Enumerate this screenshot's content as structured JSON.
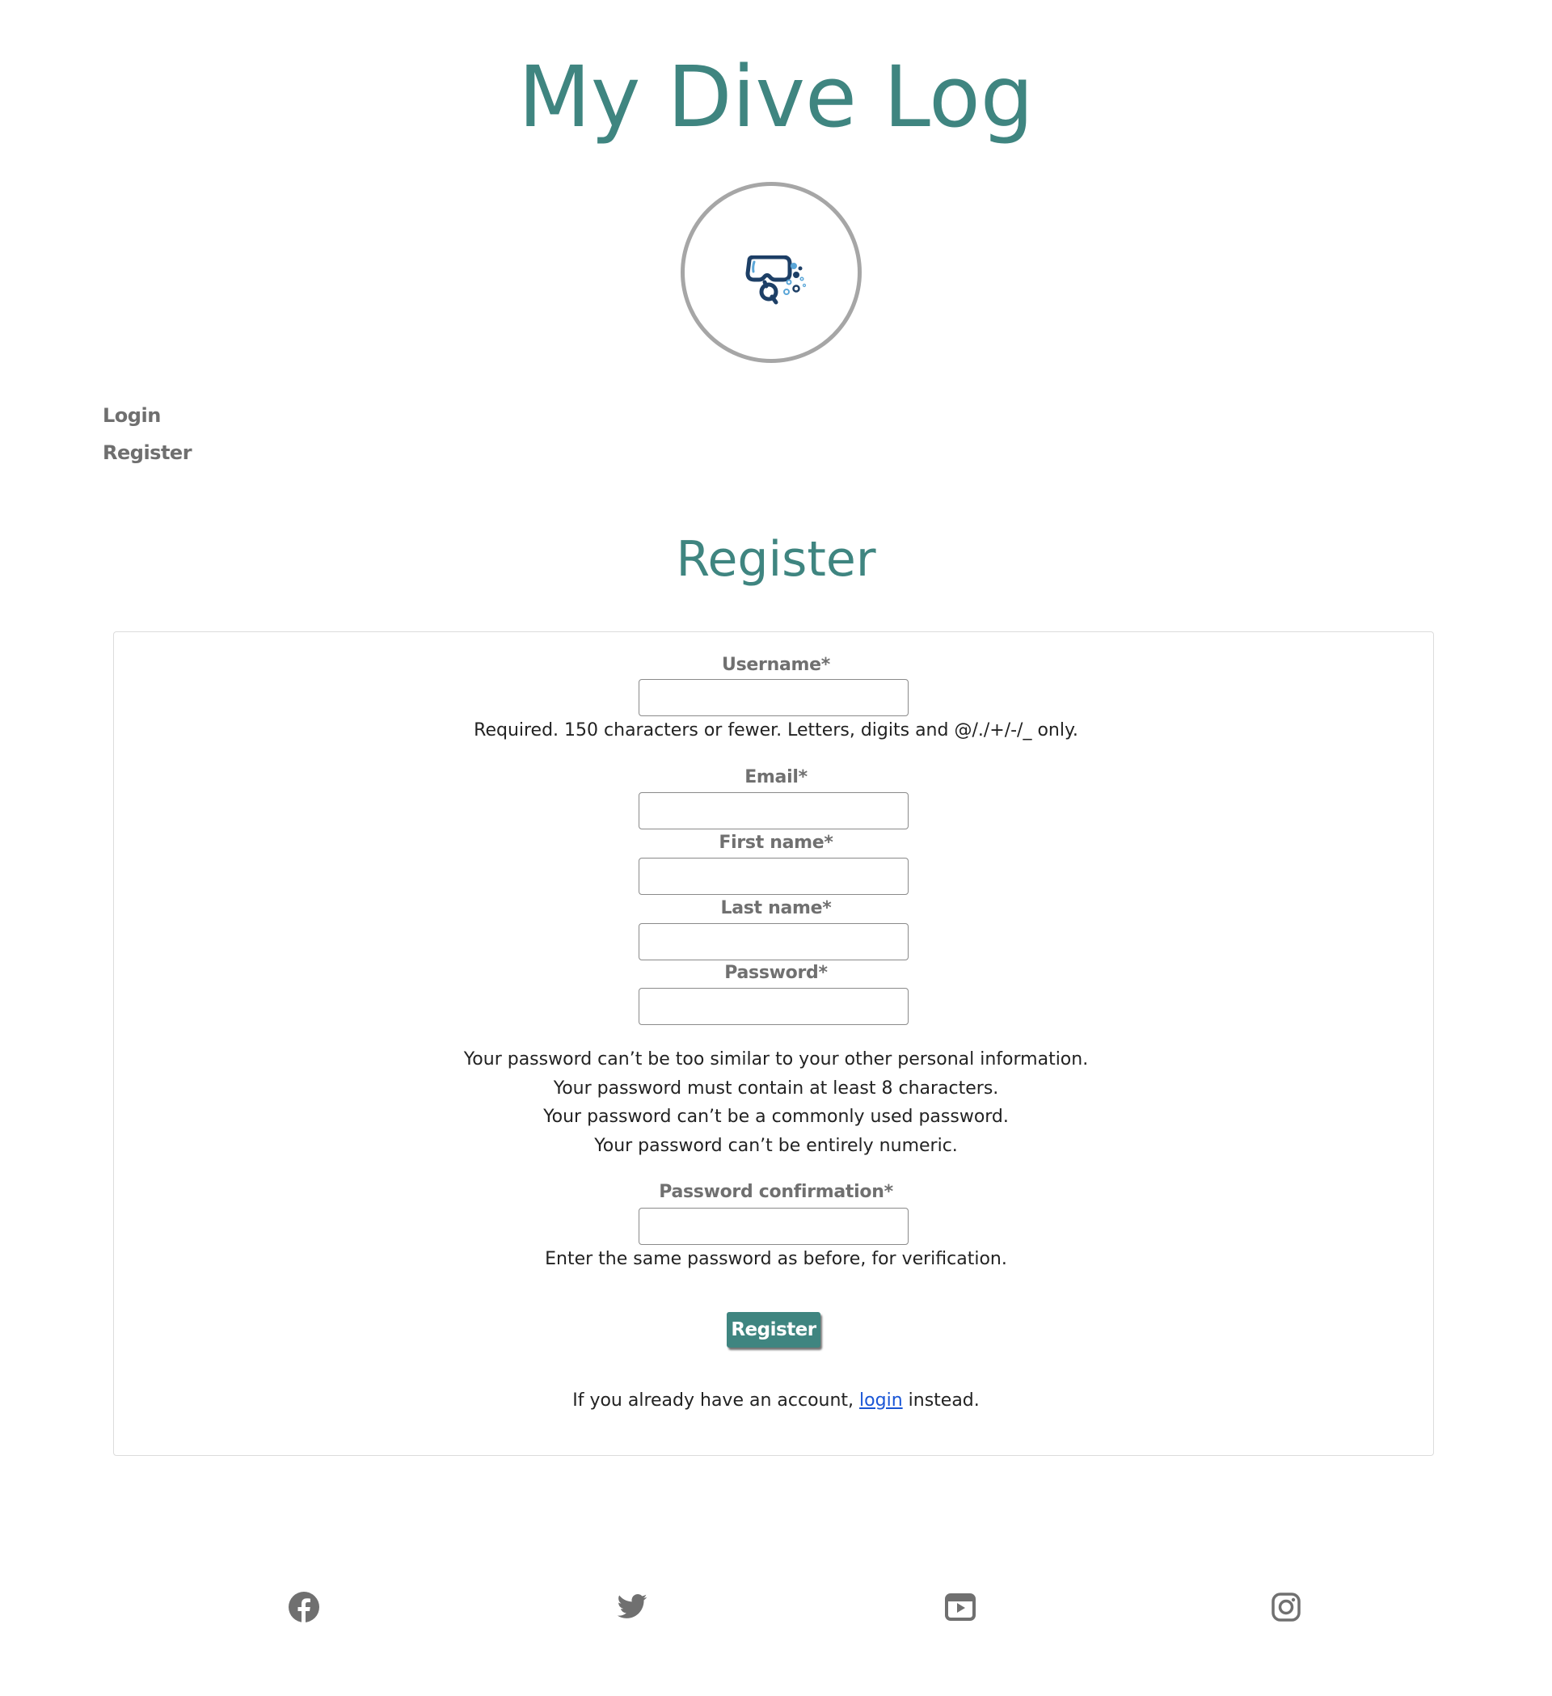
{
  "site": {
    "title": "My Dive Log",
    "logo": "diving-mask-icon"
  },
  "nav": {
    "items": [
      {
        "label": "Login"
      },
      {
        "label": "Register"
      }
    ]
  },
  "page": {
    "heading": "Register"
  },
  "form": {
    "username": {
      "label": "Username*",
      "value": "",
      "help": "Required. 150 characters or fewer. Letters, digits and @/./+/-/_ only."
    },
    "email": {
      "label": "Email*",
      "value": ""
    },
    "first_name": {
      "label": "First name*",
      "value": ""
    },
    "last_name": {
      "label": "Last name*",
      "value": ""
    },
    "password": {
      "label": "Password*",
      "value": "",
      "rules": [
        "Your password can’t be too similar to your other personal information.",
        "Your password must contain at least 8 characters.",
        "Your password can’t be a commonly used password.",
        "Your password can’t be entirely numeric."
      ]
    },
    "password_confirmation": {
      "label": "Password confirmation*",
      "value": "",
      "help": "Enter the same password as before, for verification."
    },
    "submit_label": "Register",
    "login_prompt": {
      "before": "If you already have an account, ",
      "link": "login",
      "after": " instead."
    }
  },
  "footer": {
    "social": [
      {
        "icon": "facebook-icon"
      },
      {
        "icon": "twitter-icon"
      },
      {
        "icon": "youtube-icon"
      },
      {
        "icon": "instagram-icon"
      }
    ]
  },
  "colors": {
    "accent": "#3f8580",
    "muted": "#707070",
    "link": "#1a56d6",
    "logo_border": "#a6a6a6"
  }
}
